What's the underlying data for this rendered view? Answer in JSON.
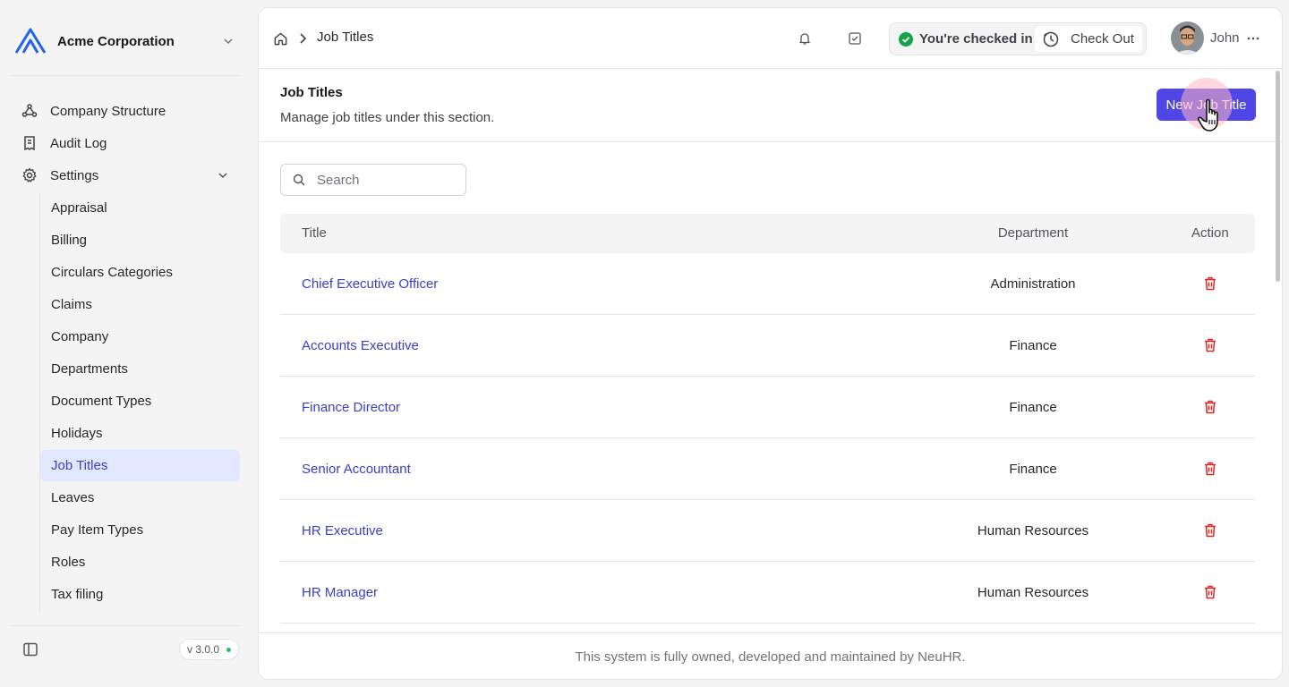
{
  "org": {
    "name": "Acme Corporation"
  },
  "nav": {
    "company_structure": "Company Structure",
    "audit_log": "Audit Log",
    "settings": "Settings"
  },
  "settings_items": [
    "Appraisal",
    "Billing",
    "Circulars Categories",
    "Claims",
    "Company",
    "Departments",
    "Document Types",
    "Holidays",
    "Job Titles",
    "Leaves",
    "Pay Item Types",
    "Roles",
    "Tax filing"
  ],
  "active_settings_item": "Job Titles",
  "version": "v 3.0.0",
  "breadcrumb": {
    "current": "Job Titles"
  },
  "status": {
    "checked_in": "You're checked in",
    "check_out": "Check Out"
  },
  "user": {
    "name": "John"
  },
  "page": {
    "title": "Job Titles",
    "subtitle": "Manage job titles under this section.",
    "new_button": "New Job Title"
  },
  "search": {
    "placeholder": "Search"
  },
  "table": {
    "headers": {
      "title": "Title",
      "department": "Department",
      "action": "Action"
    },
    "rows": [
      {
        "title": "Chief Executive Officer",
        "department": "Administration"
      },
      {
        "title": "Accounts Executive",
        "department": "Finance"
      },
      {
        "title": "Finance Director",
        "department": "Finance"
      },
      {
        "title": "Senior Accountant",
        "department": "Finance"
      },
      {
        "title": "HR Executive",
        "department": "Human Resources"
      },
      {
        "title": "HR Manager",
        "department": "Human Resources"
      }
    ]
  },
  "footer": "This system is fully owned, developed and maintained by NeuHR.",
  "colors": {
    "accent": "#4f46e5",
    "link": "#3b3fc4",
    "danger": "#dc2626",
    "success": "#16a34a"
  }
}
